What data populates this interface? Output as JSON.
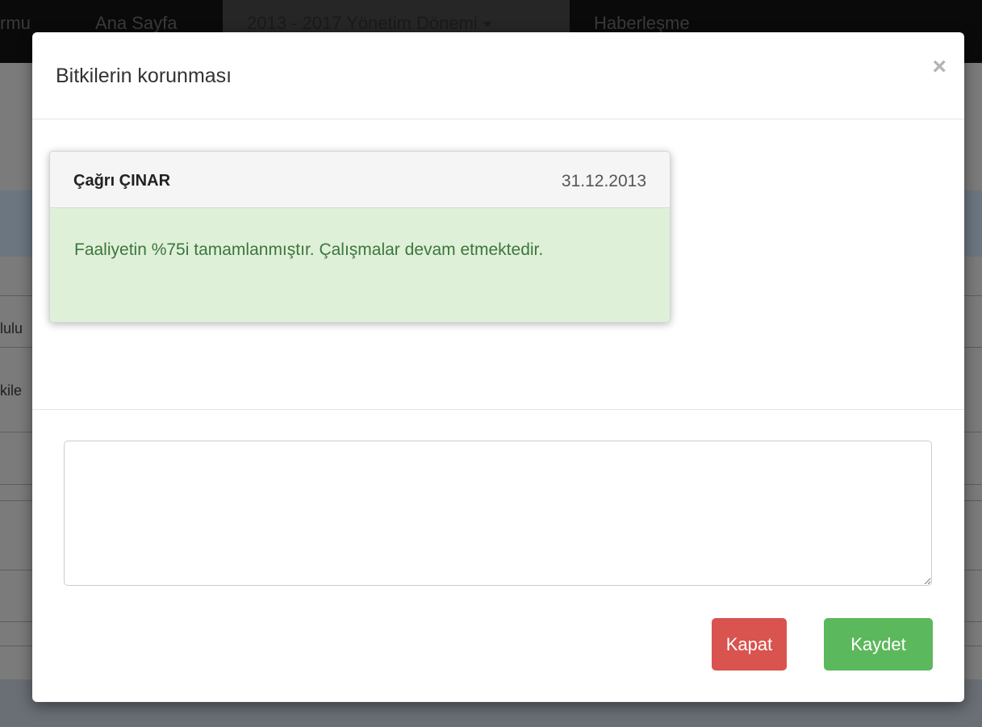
{
  "navbar": {
    "brand_fragment": "rmu",
    "home_label": "Ana Sayfa",
    "period_label": "2013 - 2017 Yönetim Dönemi",
    "communication_label": "Haberleşme"
  },
  "background": {
    "row_fragment_1": "lulu",
    "row_fragment_2": "kile"
  },
  "modal": {
    "title": "Bitkilerin korunması",
    "close_symbol": "×",
    "comment": {
      "author": "Çağrı ÇINAR",
      "date": "31.12.2013",
      "text": "Faaliyetin %75i tamamlanmıştır. Çalışmalar devam etmektedir."
    },
    "reply": {
      "value": ""
    },
    "buttons": {
      "close_label": "Kapat",
      "save_label": "Kaydet"
    }
  },
  "colors": {
    "danger": "#d9534f",
    "success": "#5cb85c",
    "comment_background": "#dff0d8",
    "comment_text": "#3c763d"
  }
}
